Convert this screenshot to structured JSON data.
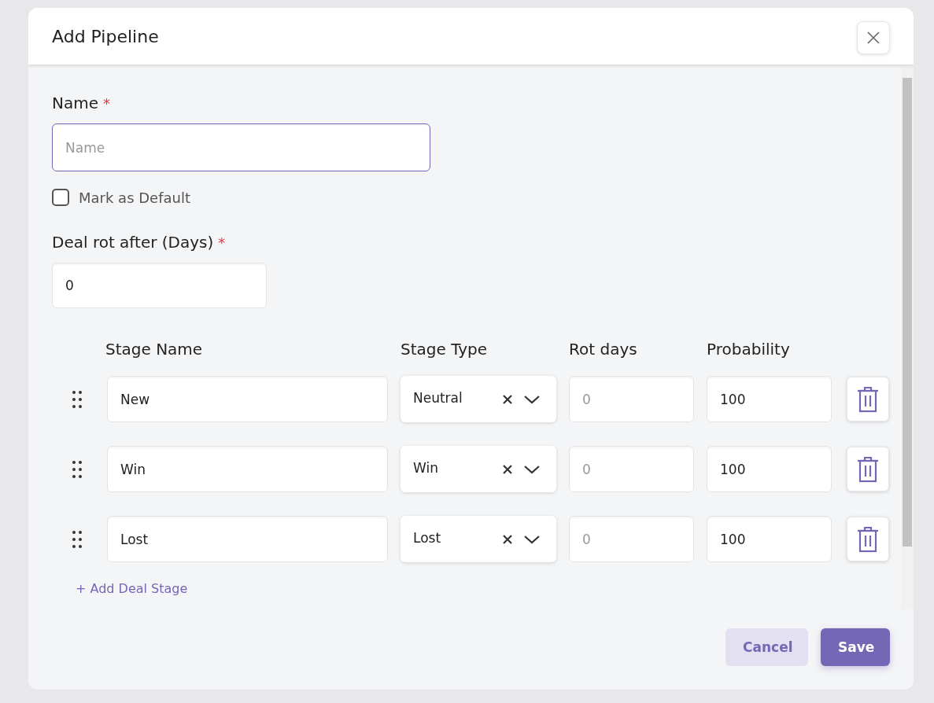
{
  "dialog": {
    "title": "Add Pipeline"
  },
  "name_field": {
    "label": "Name",
    "required_mark": "*",
    "placeholder": "Name"
  },
  "default_checkbox": {
    "label": "Mark as Default",
    "checked": false
  },
  "rot_field": {
    "label": "Deal rot after (Days)",
    "required_mark": "*",
    "value": "0"
  },
  "stages": {
    "columns": [
      "Stage Name",
      "Stage Type",
      "Rot days",
      "Probability"
    ],
    "rows": [
      {
        "name": "New",
        "type": "Neutral",
        "rot_days_placeholder": "0",
        "probability": "100"
      },
      {
        "name": "Win",
        "type": "Win",
        "rot_days_placeholder": "0",
        "probability": "100"
      },
      {
        "name": "Lost",
        "type": "Lost",
        "rot_days_placeholder": "0",
        "probability": "100"
      }
    ],
    "add_link": "+ Add Deal Stage"
  },
  "buttons": [
    {
      "label": "Cancel",
      "kind": "secondary"
    },
    {
      "label": "Save",
      "kind": "primary"
    }
  ]
}
